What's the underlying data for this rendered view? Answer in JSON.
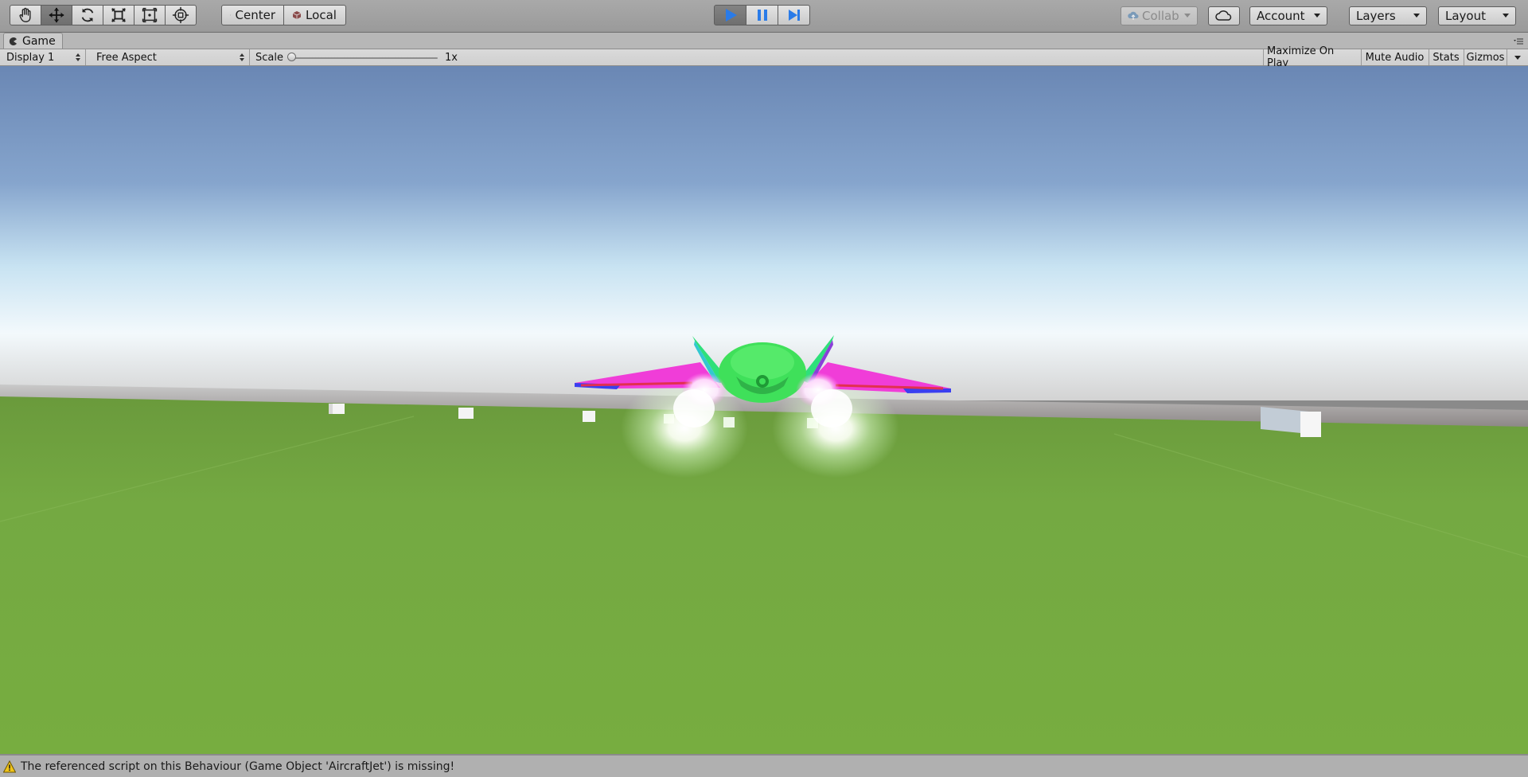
{
  "toolbar": {
    "tools": [
      {
        "name": "hand-tool",
        "active": false
      },
      {
        "name": "move-tool",
        "active": true
      },
      {
        "name": "rotate-tool",
        "active": false
      },
      {
        "name": "scale-tool",
        "active": false
      },
      {
        "name": "rect-tool",
        "active": false
      },
      {
        "name": "transform-tool",
        "active": false
      }
    ],
    "pivot_mode": "Center",
    "pivot_rotation": "Local",
    "play_state": "playing",
    "collab_label": "Collab",
    "account_label": "Account",
    "layers_label": "Layers",
    "layout_label": "Layout"
  },
  "game_tab": {
    "title": "Game"
  },
  "game_toolbar": {
    "display": "Display 1",
    "aspect": "Free Aspect",
    "scale_label": "Scale",
    "scale_value": "1x",
    "maximize_on_play": "Maximize On Play",
    "mute_audio": "Mute Audio",
    "stats": "Stats",
    "gizmos": "Gizmos"
  },
  "scene": {
    "sky_top": "#6a87b4",
    "sky_horizon": "#eef6fb",
    "ground_color": "#76ab40",
    "jet_body_color": "#3fe05a",
    "jet_wing_color": "#f03dd8",
    "jet_tip_color": "#3a3ff0"
  },
  "status": {
    "message": "The referenced script on this Behaviour (Game Object 'AircraftJet') is missing!"
  }
}
